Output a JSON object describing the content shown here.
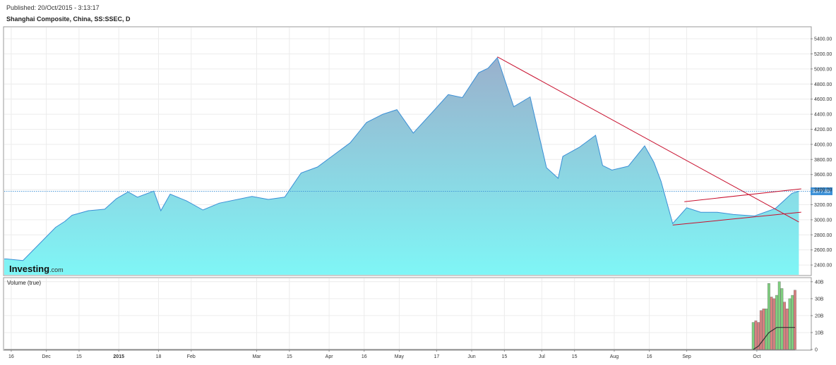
{
  "header": {
    "published": "Published: 20/Oct/2015 - 3:13:17",
    "title": "Shanghai Composite, China, SS:SSEC, D"
  },
  "watermark": {
    "brand": "Investing",
    "suffix": ".com"
  },
  "colors": {
    "line": "#3a8fd6",
    "area_top": "#9ab0cc",
    "area_bottom": "#7ff6f6",
    "trendline": "#c8102e",
    "last_price_tag": "#3a8fd6",
    "volume_up": "#7fd17f",
    "volume_down": "#d98080",
    "volume_ma": "#333333"
  },
  "chart_data": [
    {
      "type": "area",
      "title": "Shanghai Composite, China, SS:SSEC, D",
      "x_tick_labels": [
        "16",
        "Dec",
        "15",
        "2015",
        "18",
        "Feb",
        "Mar",
        "15",
        "Apr",
        "16",
        "May",
        "17",
        "Jun",
        "15",
        "Jul",
        "15",
        "Aug",
        "16",
        "Sep",
        "Oct"
      ],
      "y_tick_labels": [
        "5400.00",
        "5200.00",
        "5000.00",
        "4800.00",
        "4600.00",
        "4400.00",
        "4200.00",
        "4000.00",
        "3800.00",
        "3600.00",
        "3400.00",
        "3200.00",
        "3000.00",
        "2800.00",
        "2600.00",
        "2400.00"
      ],
      "ylim": [
        2270,
        5550
      ],
      "last_value": 3377.85,
      "last_value_label": "3377.85",
      "grid": true,
      "series": [
        {
          "x": [
            "2014-11-14",
            "2014-11-21",
            "2014-11-28",
            "2014-12-05",
            "2014-12-09",
            "2014-12-12",
            "2014-12-19",
            "2014-12-26",
            "2014-12-31",
            "2015-01-05",
            "2015-01-09",
            "2015-01-16",
            "2015-01-19",
            "2015-01-23",
            "2015-01-30",
            "2015-02-06",
            "2015-02-13",
            "2015-02-27",
            "2015-03-06",
            "2015-03-13",
            "2015-03-20",
            "2015-03-27",
            "2015-04-03",
            "2015-04-10",
            "2015-04-17",
            "2015-04-24",
            "2015-04-30",
            "2015-05-07",
            "2015-05-15",
            "2015-05-22",
            "2015-05-28",
            "2015-06-04",
            "2015-06-08",
            "2015-06-12",
            "2015-06-19",
            "2015-06-26",
            "2015-07-03",
            "2015-07-08",
            "2015-07-10",
            "2015-07-17",
            "2015-07-24",
            "2015-07-27",
            "2015-07-31",
            "2015-08-07",
            "2015-08-14",
            "2015-08-18",
            "2015-08-21",
            "2015-08-26",
            "2015-09-01",
            "2015-09-07",
            "2015-09-14",
            "2015-09-21",
            "2015-09-30",
            "2015-10-09",
            "2015-10-16",
            "2015-10-19"
          ],
          "y": [
            2480,
            2460,
            2680,
            2900,
            2980,
            3060,
            3120,
            3140,
            3280,
            3370,
            3300,
            3380,
            3120,
            3340,
            3250,
            3130,
            3220,
            3310,
            3270,
            3300,
            3620,
            3700,
            3860,
            4020,
            4290,
            4400,
            4460,
            4150,
            4420,
            4660,
            4620,
            4950,
            5010,
            5150,
            4500,
            4630,
            3690,
            3550,
            3840,
            3960,
            4120,
            3720,
            3660,
            3710,
            3980,
            3760,
            3510,
            2950,
            3160,
            3100,
            3100,
            3070,
            3050,
            3150,
            3350,
            3378
          ]
        }
      ]
    },
    {
      "type": "bar",
      "title": "Volume (true)",
      "y_tick_labels": [
        "40B",
        "30B",
        "20B",
        "10B",
        "0"
      ],
      "ylim": [
        0,
        42
      ],
      "series": [
        {
          "x": [
            "2015-09-18",
            "2015-09-21",
            "2015-09-22",
            "2015-09-23",
            "2015-09-24",
            "2015-09-25",
            "2015-09-28",
            "2015-09-29",
            "2015-09-30",
            "2015-10-08",
            "2015-10-09",
            "2015-10-12",
            "2015-10-13",
            "2015-10-14",
            "2015-10-15",
            "2015-10-16",
            "2015-10-19"
          ],
          "values": [
            16,
            17,
            16,
            23,
            24,
            24,
            39,
            31,
            30,
            32,
            40,
            36,
            28,
            24,
            30,
            32,
            35
          ],
          "direction": [
            "up",
            "down",
            "down",
            "down",
            "down",
            "up",
            "up",
            "down",
            "down",
            "up",
            "up",
            "up",
            "down",
            "down",
            "up",
            "up",
            "down"
          ]
        },
        {
          "name": "moving average",
          "values": [
            0,
            1,
            2,
            4,
            6,
            8,
            10,
            11,
            12,
            13,
            13,
            13,
            13,
            13,
            13,
            13,
            13
          ]
        }
      ]
    }
  ]
}
